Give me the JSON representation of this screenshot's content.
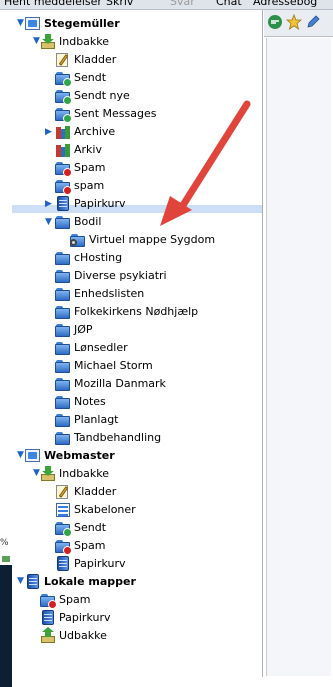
{
  "menubar": {
    "items": [
      {
        "label": "Hent meddelelser",
        "disabled": false
      },
      {
        "label": "Skriv",
        "disabled": false
      },
      {
        "label": "Svar",
        "disabled": true
      },
      {
        "label": "Chat",
        "disabled": false
      },
      {
        "label": "Adressebog",
        "disabled": false
      }
    ]
  },
  "leftstrip": {
    "percent_text": "%"
  },
  "tree": {
    "accounts": [
      {
        "label": "Stegemüller"
      },
      {
        "label": "Webmaster"
      },
      {
        "label": "Lokale mapper"
      }
    ],
    "stegemuller": [
      {
        "label": "Indbakke"
      },
      {
        "label": "Kladder"
      },
      {
        "label": "Sendt"
      },
      {
        "label": "Sendt nye"
      },
      {
        "label": "Sent Messages"
      },
      {
        "label": "Archive"
      },
      {
        "label": "Arkiv"
      },
      {
        "label": "Spam"
      },
      {
        "label": "spam"
      },
      {
        "label": "Papirkurv"
      },
      {
        "label": "Bodil"
      },
      {
        "label": "Virtuel mappe Sygdom"
      },
      {
        "label": "cHosting"
      },
      {
        "label": "Diverse psykiatri"
      },
      {
        "label": "Enhedslisten"
      },
      {
        "label": "Folkekirkens Nødhjælp"
      },
      {
        "label": "JØP"
      },
      {
        "label": "Lønsedler"
      },
      {
        "label": "Michael Storm"
      },
      {
        "label": "Mozilla Danmark"
      },
      {
        "label": "Notes"
      },
      {
        "label": "Planlagt"
      },
      {
        "label": "Tandbehandling"
      }
    ],
    "webmaster": [
      {
        "label": "Indbakke"
      },
      {
        "label": "Kladder"
      },
      {
        "label": "Skabeloner"
      },
      {
        "label": "Sendt"
      },
      {
        "label": "Spam"
      },
      {
        "label": "Papirkurv"
      }
    ],
    "lokale": [
      {
        "label": "Spam"
      },
      {
        "label": "Papirkurv"
      },
      {
        "label": "Udbakke"
      }
    ]
  },
  "colors": {
    "accent": "#2f6cc4",
    "highlight": "#c7dcf6",
    "annotation_arrow": "#e0443a"
  },
  "icons": [
    "account-icon",
    "inbox-icon",
    "folder-icon",
    "drafts-icon",
    "sent-icon",
    "archive-icon",
    "spam-icon",
    "trash-icon",
    "virtual-folder-icon",
    "templates-icon",
    "local-folders-icon",
    "outbox-icon",
    "chat-icon",
    "star-icon",
    "pencil-icon"
  ]
}
